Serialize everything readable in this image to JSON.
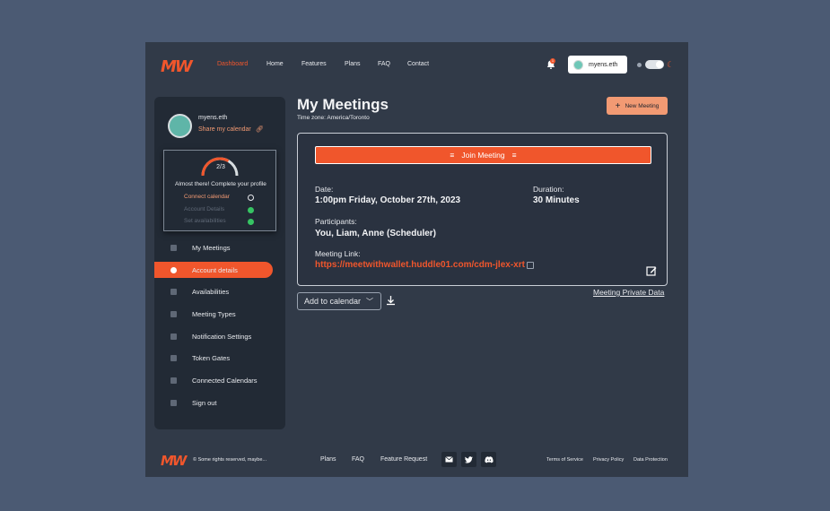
{
  "brand": {
    "logo": "MW",
    "accent": "#f0562c",
    "peach": "#f29a73"
  },
  "nav": {
    "links": [
      {
        "label": "Dashboard",
        "active": true
      },
      {
        "label": "Home"
      },
      {
        "label": "Features"
      },
      {
        "label": "Plans"
      },
      {
        "label": "FAQ"
      },
      {
        "label": "Contact"
      }
    ],
    "notifications": "1",
    "user": "myens.eth"
  },
  "sidebar": {
    "profile_name": "myens.eth",
    "share_label": "Share my calendar",
    "progress": {
      "count": "2/3",
      "fraction": 0.667,
      "message": "Almost there! Complete your profile",
      "steps": [
        {
          "label": "Connect calendar",
          "done": false
        },
        {
          "label": "Account Details",
          "done": true
        },
        {
          "label": "Set availabilities",
          "done": true
        }
      ]
    },
    "items": [
      {
        "label": "My Meetings"
      },
      {
        "label": "Account details",
        "active": true
      },
      {
        "label": "Availabilities"
      },
      {
        "label": "Meeting Types"
      },
      {
        "label": "Notification Settings"
      },
      {
        "label": "Token Gates"
      },
      {
        "label": "Connected Calendars"
      },
      {
        "label": "Sign out"
      }
    ]
  },
  "main": {
    "title": "My Meetings",
    "timezone": "Time zone: America/Toronto",
    "new_meeting": "New Meeting",
    "meeting": {
      "join": "Join Meeting",
      "date_label": "Date:",
      "date_value": "1:00pm Friday, October 27th, 2023",
      "duration_label": "Duration:",
      "duration_value": "30 Minutes",
      "participants_label": "Participants:",
      "participants_value": "You, Liam, Anne (Scheduler)",
      "link_label": "Meeting Link:",
      "link_value": "https://meetwithwallet.huddle01.com/cdm-jlex-xrt"
    },
    "add_to_calendar": "Add to calendar",
    "private_data": "Meeting Private Data"
  },
  "footer": {
    "copyright": "© Some rights reserved, maybe...",
    "links": [
      "Plans",
      "FAQ",
      "Feature Request"
    ],
    "legal": [
      "Terms of Service",
      "Privacy Policy",
      "Data Protection"
    ]
  }
}
